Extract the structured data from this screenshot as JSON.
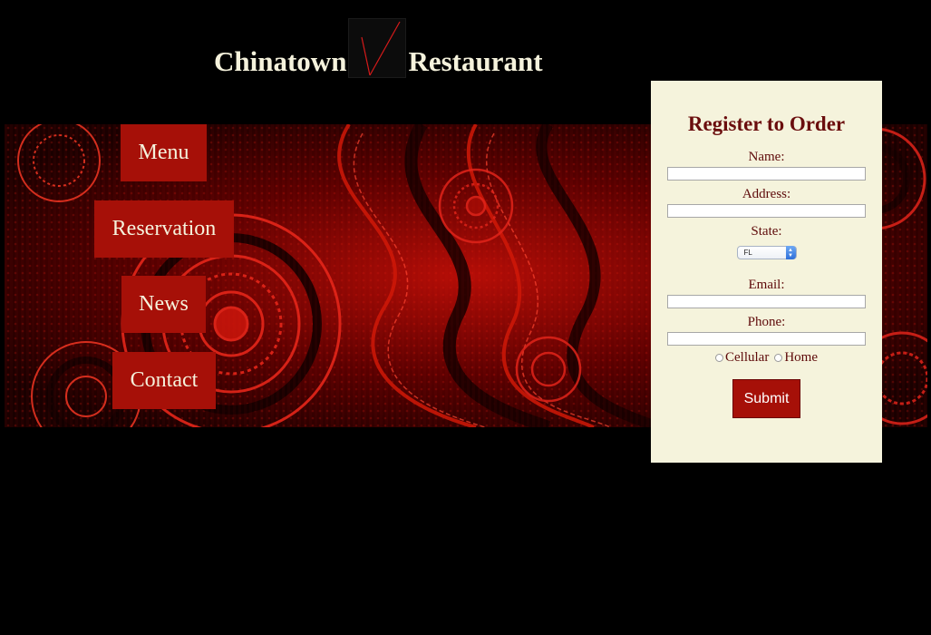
{
  "header": {
    "title_left": "Chinatown",
    "title_right": "Restaurant",
    "logo_icon": "teapot-logo-icon"
  },
  "nav": {
    "items": [
      {
        "label": "Menu"
      },
      {
        "label": "Reservation"
      },
      {
        "label": "News"
      },
      {
        "label": "Contact"
      }
    ]
  },
  "register": {
    "title": "Register to Order",
    "name_label": "Name:",
    "name_value": "",
    "address_label": "Address:",
    "address_value": "",
    "state_label": "State:",
    "state_selected": "FL",
    "email_label": "Email:",
    "email_value": "",
    "phone_label": "Phone:",
    "phone_value": "",
    "phone_type_options": [
      "Cellular",
      "Home"
    ],
    "submit_label": "Submit"
  },
  "colors": {
    "background": "#000000",
    "accent_red": "#a61008",
    "panel_cream": "#f5f3dc",
    "title_cream": "#f5f2dc",
    "label_maroon": "#5e0a0a"
  }
}
